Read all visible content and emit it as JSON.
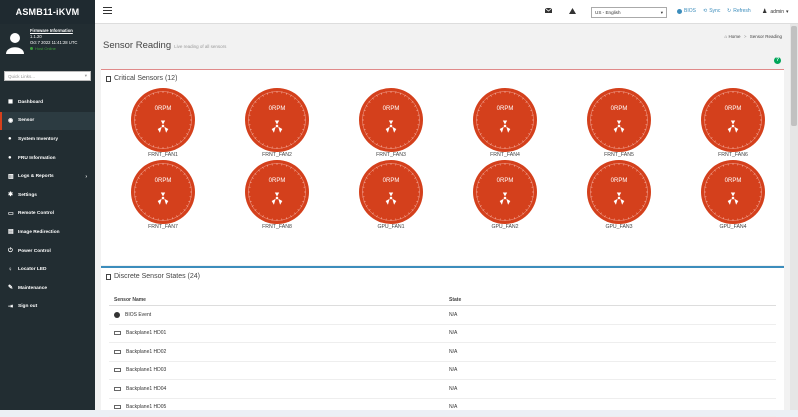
{
  "app": {
    "brand": "ASMB11-iKVM"
  },
  "user_panel": {
    "fw_link": "Firmware Information",
    "fw_version": "1.1.20",
    "fw_date": "Oct 7 2022 11:41:28 UTC",
    "host_status": "Host Online"
  },
  "quick_links": {
    "placeholder": "Quick Links..."
  },
  "menu": [
    {
      "label": "Dashboard",
      "icon": "dashboard-icon"
    },
    {
      "label": "Sensor",
      "icon": "sensor-icon",
      "active": true
    },
    {
      "label": "System Inventory",
      "icon": "info-icon"
    },
    {
      "label": "FRU Information",
      "icon": "info-icon"
    },
    {
      "label": "Logs & Reports",
      "icon": "chart-icon",
      "has_submenu": true
    },
    {
      "label": "Settings",
      "icon": "gear-icon"
    },
    {
      "label": "Remote Control",
      "icon": "monitor-icon"
    },
    {
      "label": "Image Redirection",
      "icon": "disk-icon"
    },
    {
      "label": "Power Control",
      "icon": "power-icon"
    },
    {
      "label": "Locator LED",
      "icon": "lightbulb-icon"
    },
    {
      "label": "Maintenance",
      "icon": "wrench-icon"
    },
    {
      "label": "Sign out",
      "icon": "signout-icon"
    }
  ],
  "topbar": {
    "language": "US - English",
    "bios": "BIOS",
    "sync": "Sync",
    "refresh": "Refresh",
    "user": "admin"
  },
  "header": {
    "title": "Sensor Reading",
    "subtitle": "Live reading of all sensors",
    "breadcrumb_home": "Home",
    "breadcrumb_sep": ">",
    "breadcrumb_current": "Sensor Reading"
  },
  "critical": {
    "title": "Critical Sensors (12)",
    "value_text": "0RPM",
    "sensors": [
      "FRNT_FAN1",
      "FRNT_FAN2",
      "FRNT_FAN3",
      "FRNT_FAN4",
      "FRNT_FAN5",
      "FRNT_FAN6",
      "FRNT_FAN7",
      "FRNT_FAN8",
      "GPU_FAN1",
      "GPU_FAN2",
      "GPU_FAN3",
      "GPU_FAN4"
    ],
    "gauge_color": "#d4401c"
  },
  "discrete": {
    "title": "Discrete Sensor States (24)",
    "columns": [
      "Sensor Name",
      "State"
    ],
    "rows": [
      {
        "name": "BIOS Event",
        "state": "N/A",
        "icon": "info-icon"
      },
      {
        "name": "Backplane1 HD01",
        "state": "N/A",
        "icon": "drive-icon"
      },
      {
        "name": "Backplane1 HD02",
        "state": "N/A",
        "icon": "drive-icon"
      },
      {
        "name": "Backplane1 HD03",
        "state": "N/A",
        "icon": "drive-icon"
      },
      {
        "name": "Backplane1 HD04",
        "state": "N/A",
        "icon": "drive-icon"
      },
      {
        "name": "Backplane1 HD05",
        "state": "N/A",
        "icon": "drive-icon"
      }
    ]
  }
}
